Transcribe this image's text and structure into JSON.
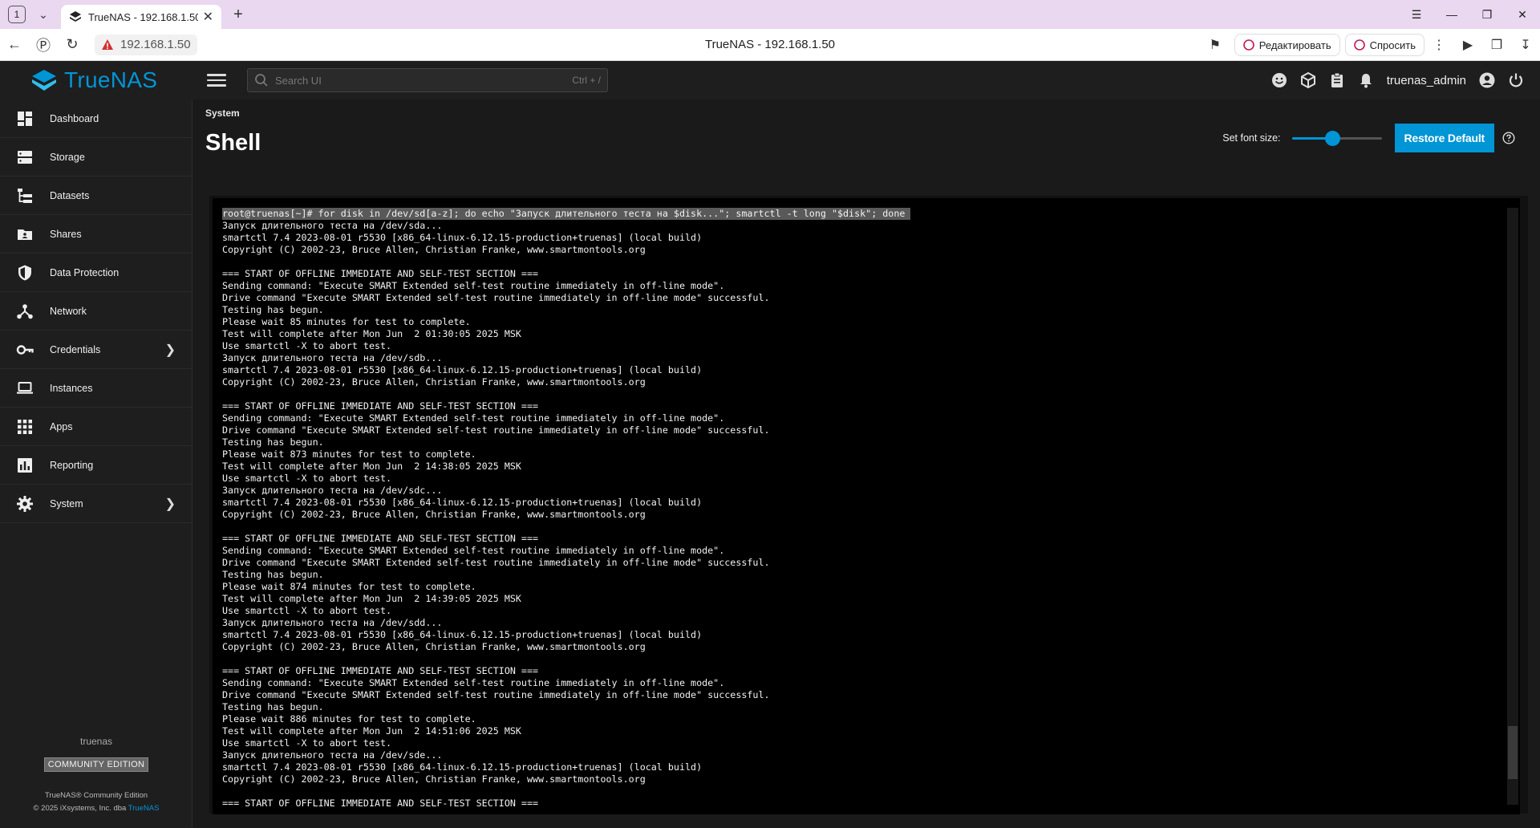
{
  "browser": {
    "tab_count": "1",
    "tab_title": "TrueNAS - 192.168.1.50",
    "address_host": "192.168.1.50",
    "page_title": "TrueNAS - 192.168.1.50",
    "edit_label": "Редактировать",
    "ask_label": "Спросить"
  },
  "topbar": {
    "brand": "TrueNAS",
    "search_placeholder": "Search UI",
    "search_shortcut": "Ctrl + /",
    "username": "truenas_admin"
  },
  "sidebar": {
    "items": [
      {
        "label": "Dashboard",
        "icon": "dashboard-icon"
      },
      {
        "label": "Storage",
        "icon": "storage-icon"
      },
      {
        "label": "Datasets",
        "icon": "datasets-icon"
      },
      {
        "label": "Shares",
        "icon": "shares-icon"
      },
      {
        "label": "Data Protection",
        "icon": "shield-icon"
      },
      {
        "label": "Network",
        "icon": "network-icon"
      },
      {
        "label": "Credentials",
        "icon": "key-icon"
      },
      {
        "label": "Instances",
        "icon": "laptop-icon"
      },
      {
        "label": "Apps",
        "icon": "apps-grid-icon"
      },
      {
        "label": "Reporting",
        "icon": "bar-chart-icon"
      },
      {
        "label": "System",
        "icon": "gear-icon"
      }
    ],
    "hostname": "truenas",
    "edition_badge": "COMMUNITY EDITION",
    "copyright_line1": "TrueNAS® Community Edition",
    "copyright_line2": "© 2025 iXsystems, Inc. dba",
    "copyright_link": "TrueNAS"
  },
  "main": {
    "breadcrumb": "System",
    "title": "Shell",
    "font_size_label": "Set font size:",
    "font_size_level": 0.45,
    "restore_label": "Restore Default"
  },
  "colors": {
    "accent": "#0095d5",
    "background": "#1e1e1e",
    "terminal_bg": "#000000"
  },
  "terminal": {
    "lines": [
      "root@truenas[~]# for disk in /dev/sd[a-z]; do echo \"Запуск длительного теста на $disk...\"; smartctl -t long \"$disk\"; done ",
      "Запуск длительного теста на /dev/sda...",
      "smartctl 7.4 2023-08-01 r5530 [x86_64-linux-6.12.15-production+truenas] (local build)",
      "Copyright (C) 2002-23, Bruce Allen, Christian Franke, www.smartmontools.org",
      "",
      "=== START OF OFFLINE IMMEDIATE AND SELF-TEST SECTION ===",
      "Sending command: \"Execute SMART Extended self-test routine immediately in off-line mode\".",
      "Drive command \"Execute SMART Extended self-test routine immediately in off-line mode\" successful.",
      "Testing has begun.",
      "Please wait 85 minutes for test to complete.",
      "Test will complete after Mon Jun  2 01:30:05 2025 MSK",
      "Use smartctl -X to abort test.",
      "Запуск длительного теста на /dev/sdb...",
      "smartctl 7.4 2023-08-01 r5530 [x86_64-linux-6.12.15-production+truenas] (local build)",
      "Copyright (C) 2002-23, Bruce Allen, Christian Franke, www.smartmontools.org",
      "",
      "=== START OF OFFLINE IMMEDIATE AND SELF-TEST SECTION ===",
      "Sending command: \"Execute SMART Extended self-test routine immediately in off-line mode\".",
      "Drive command \"Execute SMART Extended self-test routine immediately in off-line mode\" successful.",
      "Testing has begun.",
      "Please wait 873 minutes for test to complete.",
      "Test will complete after Mon Jun  2 14:38:05 2025 MSK",
      "Use smartctl -X to abort test.",
      "Запуск длительного теста на /dev/sdc...",
      "smartctl 7.4 2023-08-01 r5530 [x86_64-linux-6.12.15-production+truenas] (local build)",
      "Copyright (C) 2002-23, Bruce Allen, Christian Franke, www.smartmontools.org",
      "",
      "=== START OF OFFLINE IMMEDIATE AND SELF-TEST SECTION ===",
      "Sending command: \"Execute SMART Extended self-test routine immediately in off-line mode\".",
      "Drive command \"Execute SMART Extended self-test routine immediately in off-line mode\" successful.",
      "Testing has begun.",
      "Please wait 874 minutes for test to complete.",
      "Test will complete after Mon Jun  2 14:39:05 2025 MSK",
      "Use smartctl -X to abort test.",
      "Запуск длительного теста на /dev/sdd...",
      "smartctl 7.4 2023-08-01 r5530 [x86_64-linux-6.12.15-production+truenas] (local build)",
      "Copyright (C) 2002-23, Bruce Allen, Christian Franke, www.smartmontools.org",
      "",
      "=== START OF OFFLINE IMMEDIATE AND SELF-TEST SECTION ===",
      "Sending command: \"Execute SMART Extended self-test routine immediately in off-line mode\".",
      "Drive command \"Execute SMART Extended self-test routine immediately in off-line mode\" successful.",
      "Testing has begun.",
      "Please wait 886 minutes for test to complete.",
      "Test will complete after Mon Jun  2 14:51:06 2025 MSK",
      "Use smartctl -X to abort test.",
      "Запуск длительного теста на /dev/sde...",
      "smartctl 7.4 2023-08-01 r5530 [x86_64-linux-6.12.15-production+truenas] (local build)",
      "Copyright (C) 2002-23, Bruce Allen, Christian Franke, www.smartmontools.org",
      "",
      "=== START OF OFFLINE IMMEDIATE AND SELF-TEST SECTION ==="
    ]
  }
}
